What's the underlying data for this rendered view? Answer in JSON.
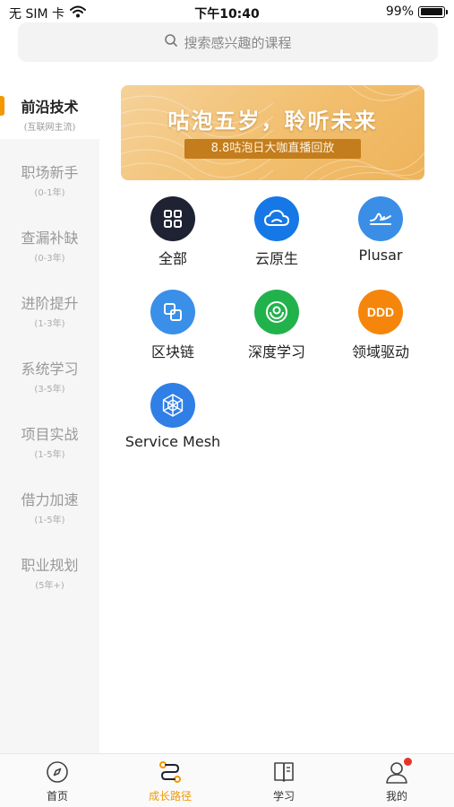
{
  "status_bar": {
    "carrier": "无 SIM 卡",
    "time": "下午10:40",
    "battery": "99%",
    "battery_level": 0.99
  },
  "search": {
    "placeholder": "搜索感兴趣的课程"
  },
  "sidebar": {
    "items": [
      {
        "title": "前沿技术",
        "sub": "(互联网主流)",
        "active": true
      },
      {
        "title": "职场新手",
        "sub": "(0-1年)"
      },
      {
        "title": "查漏补缺",
        "sub": "(0-3年)"
      },
      {
        "title": "进阶提升",
        "sub": "(1-3年)"
      },
      {
        "title": "系统学习",
        "sub": "(3-5年)"
      },
      {
        "title": "项目实战",
        "sub": "(1-5年)"
      },
      {
        "title": "借力加速",
        "sub": "(1-5年)"
      },
      {
        "title": "职业规划",
        "sub": "(5年+)"
      }
    ]
  },
  "banner": {
    "title": "咕泡五岁，聆听未来",
    "subtitle": "8.8咕泡日大咖直播回放"
  },
  "categories": [
    {
      "label": "全部",
      "icon": "grid-icon",
      "color": "#1e2233"
    },
    {
      "label": "云原生",
      "icon": "cloud-icon",
      "color": "#1677e6"
    },
    {
      "label": "Plusar",
      "icon": "wave-icon",
      "color": "#3a8ee6"
    },
    {
      "label": "区块链",
      "icon": "blocks-icon",
      "color": "#3a8fe8"
    },
    {
      "label": "深度学习",
      "icon": "target-icon",
      "color": "#22b24c"
    },
    {
      "label": "领域驱动",
      "icon": "ddd-icon",
      "icon_text": "DDD",
      "color": "#f5860b"
    },
    {
      "label": "Service Mesh",
      "icon": "mesh-icon",
      "color": "#2f7fe6"
    }
  ],
  "bottom_nav": {
    "items": [
      {
        "label": "首页",
        "icon": "compass-icon"
      },
      {
        "label": "成长路径",
        "icon": "path-icon",
        "active": true
      },
      {
        "label": "学习",
        "icon": "book-icon"
      },
      {
        "label": "我的",
        "icon": "profile-icon",
        "badge": true
      }
    ]
  },
  "colors": {
    "accent": "#f39800",
    "badge": "#e8332d"
  }
}
